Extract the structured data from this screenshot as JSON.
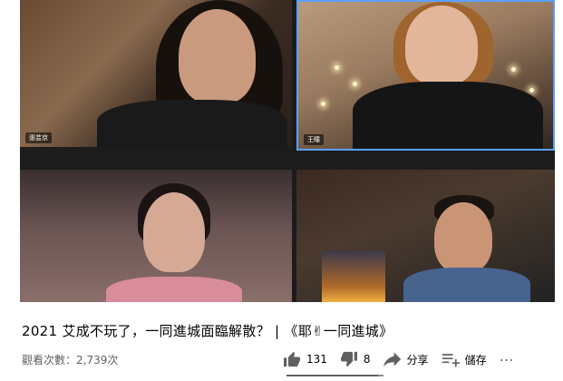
{
  "video": {
    "participants": [
      "張芸京",
      "王瞳",
      "",
      ""
    ]
  },
  "meta": {
    "title": "2021 艾成不玩了，一同進城面臨解散？ | 《耶✌一同進城》",
    "views": "觀看次數：2,739次"
  },
  "actions": {
    "like_count": "131",
    "dislike_count": "8",
    "share_label": "分享",
    "save_label": "儲存",
    "more_label": "⋯"
  },
  "like_ratio": 0.94,
  "icons": [
    "thumbs-up-icon",
    "thumbs-down-icon",
    "share-icon",
    "playlist-add-icon",
    "more-icon"
  ]
}
